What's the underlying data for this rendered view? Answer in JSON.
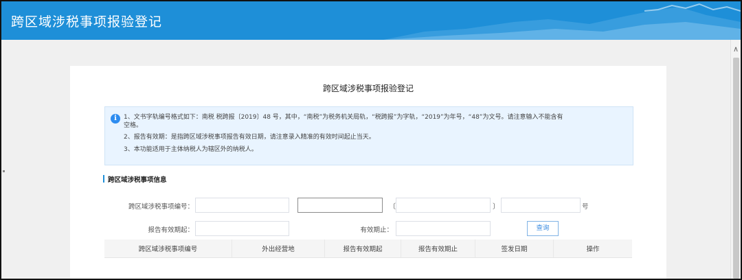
{
  "window": {
    "title": "跨区域涉税事项报验登记"
  },
  "page": {
    "heading": "跨区域涉税事项报验登记",
    "notice": {
      "lines": [
        "1、文书字轨编号格式如下：南税 税跨报〔2019〕48 号，其中，“南税”为税务机关局轨，“税跨报”为字轨，“2019”为年号，“48”为文号。请注意输入不能含有",
        "空格。",
        "2、报告有效期：是指跨区域涉税事项报告有效日期，请注意录入精准的有效时间起止当天。",
        "3、本功能适用于主体纳税人为辖区外的纳税人。"
      ]
    },
    "section_title": "跨区域涉税事项信息",
    "form": {
      "number_label": "跨区域涉税事项编号：",
      "bracket_open": "〔",
      "bracket_close": "〕",
      "number_suffix": "号",
      "start_label": "报告有效期起：",
      "end_label": "有效期止：",
      "query_button": "查询",
      "field_values": {
        "office": "",
        "track": "",
        "year": "",
        "serial": "",
        "start": "",
        "end": ""
      }
    },
    "table": {
      "columns": [
        "跨区域涉税事项编号",
        "外出经营地",
        "报告有效期起",
        "报告有效期止",
        "签发日期",
        "操作"
      ],
      "rows": []
    }
  },
  "colors": {
    "header": "#1e8fd8",
    "accent": "#2d8cf0",
    "notice_bg": "#e9f4ff"
  },
  "icons": {
    "notice": "info-icon",
    "scroll": "chevron-up-icon"
  }
}
